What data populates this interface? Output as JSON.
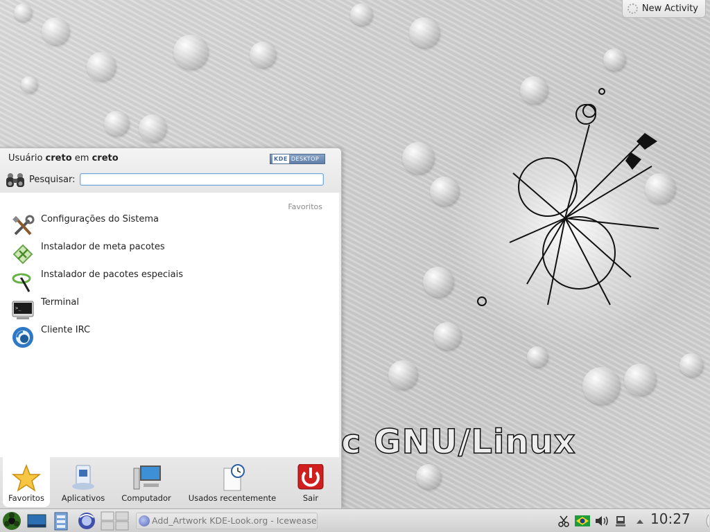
{
  "desktop": {
    "wallpaper_text": "c GNU/Linux",
    "new_activity_label": "New Activity"
  },
  "launcher": {
    "user_prefix": "Usuário",
    "user_name": "creto",
    "host_connector": "em",
    "host_name": "creto",
    "badge_k": "KDE",
    "badge_text": "DESKTOP",
    "search_label": "Pesquisar:",
    "search_value": "",
    "favorites_title": "Favoritos",
    "favorites": [
      {
        "label": "Configurações do Sistema",
        "icon": "tools-icon"
      },
      {
        "label": "Instalador de meta pacotes",
        "icon": "package-installer-icon"
      },
      {
        "label": "Instalador de pacotes especiais",
        "icon": "special-package-icon"
      },
      {
        "label": "Terminal",
        "icon": "terminal-icon"
      },
      {
        "label": "Cliente IRC",
        "icon": "irc-client-icon"
      }
    ],
    "tabs": [
      {
        "label": "Favoritos",
        "icon": "star-icon",
        "active": true
      },
      {
        "label": "Aplicativos",
        "icon": "applications-icon",
        "active": false
      },
      {
        "label": "Computador",
        "icon": "computer-icon",
        "active": false
      },
      {
        "label": "Usados recentemente",
        "icon": "recent-clock-icon",
        "active": false
      },
      {
        "label": "Sair",
        "icon": "power-icon",
        "active": false
      }
    ]
  },
  "taskbar": {
    "task_label": "Add_Artwork KDE-Look.org - Iceweasel",
    "clock": "10:27",
    "colors": {
      "accent": "#d11f1f",
      "launcher_green": "#2f6b1f"
    }
  }
}
